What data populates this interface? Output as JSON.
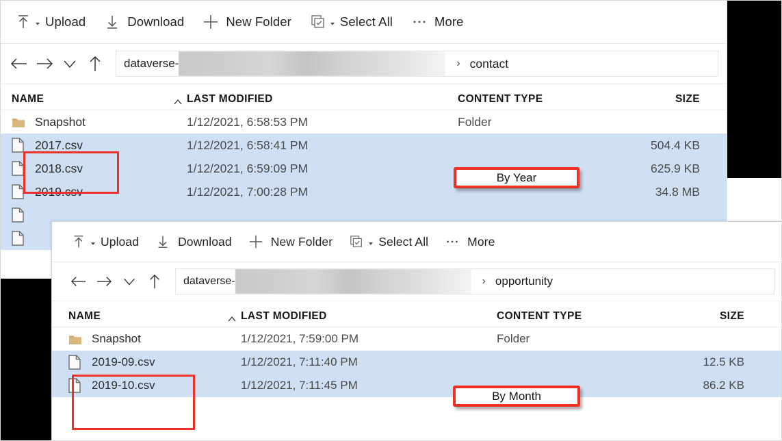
{
  "toolbar": {
    "items": [
      {
        "label": "Upload",
        "icon": "upload-icon",
        "has_caret": true
      },
      {
        "label": "Download",
        "icon": "download-icon",
        "has_caret": false
      },
      {
        "label": "New Folder",
        "icon": "plus-icon",
        "has_caret": false
      },
      {
        "label": "Select All",
        "icon": "select-all-icon",
        "has_caret": true
      },
      {
        "label": "More",
        "icon": "ellipsis-icon",
        "has_caret": false
      }
    ]
  },
  "nav": {
    "back": "back-arrow-icon",
    "forward": "forward-arrow-icon",
    "history": "chevron-down-icon",
    "up": "up-arrow-icon"
  },
  "columns": {
    "name": "NAME",
    "last_modified": "LAST MODIFIED",
    "content_type": "CONTENT TYPE",
    "size": "SIZE",
    "sort_indicator": "sort-ascending-icon"
  },
  "window_contact": {
    "breadcrumb": {
      "root": "dataverse-",
      "redacted": "",
      "separator": "›",
      "leaf": "contact"
    },
    "rows": [
      {
        "name": "Snapshot",
        "icon": "folder-icon",
        "modified": "1/12/2021, 6:58:53 PM",
        "type": "Folder",
        "size": "",
        "selected": false
      },
      {
        "name": "2017.csv",
        "icon": "file-icon",
        "modified": "1/12/2021, 6:58:41 PM",
        "type": "",
        "size": "504.4 KB",
        "selected": true
      },
      {
        "name": "2018.csv",
        "icon": "file-icon",
        "modified": "1/12/2021, 6:59:09 PM",
        "type": "",
        "size": "625.9 KB",
        "selected": true
      },
      {
        "name": "2019.csv",
        "icon": "file-icon",
        "modified": "1/12/2021, 7:00:28 PM",
        "type": "",
        "size": "34.8 MB",
        "selected": true
      },
      {
        "name": "",
        "icon": "file-icon",
        "modified": "",
        "type": "",
        "size": "",
        "selected": true
      },
      {
        "name": "",
        "icon": "file-icon",
        "modified": "",
        "type": "",
        "size": "",
        "selected": true
      }
    ]
  },
  "window_opportunity": {
    "breadcrumb": {
      "root": "dataverse-",
      "redacted": "",
      "separator": "›",
      "leaf": "opportunity"
    },
    "rows": [
      {
        "name": "Snapshot",
        "icon": "folder-icon",
        "modified": "1/12/2021, 7:59:00 PM",
        "type": "Folder",
        "size": "",
        "selected": false
      },
      {
        "name": "2019-09.csv",
        "icon": "file-icon",
        "modified": "1/12/2021, 7:11:40 PM",
        "type": "",
        "size": "12.5 KB",
        "selected": true
      },
      {
        "name": "2019-10.csv",
        "icon": "file-icon",
        "modified": "1/12/2021, 7:11:45 PM",
        "type": "",
        "size": "86.2 KB",
        "selected": true
      }
    ]
  },
  "annotations": {
    "by_year": "By Year",
    "by_month": "By Month",
    "accent_color": "#ee3124"
  },
  "colors": {
    "selection": "#cfe0f4",
    "folder": "#d3a86a",
    "text": "#4a4a4a",
    "annotation_red": "#ee3124"
  }
}
